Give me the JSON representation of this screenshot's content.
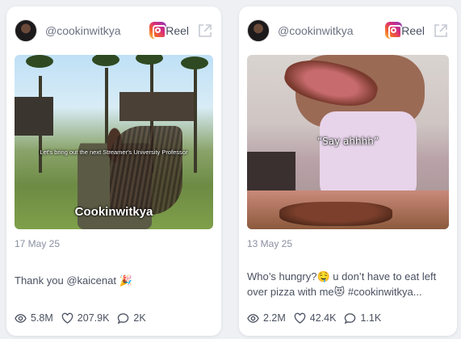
{
  "posts": [
    {
      "handle": "@cookinwitkya",
      "platform_label": "Reel",
      "overlay_small": "Let's bring out the next Streamer's University Professor",
      "overlay_big": "Cookinwitkya",
      "date": "17 May 25",
      "caption": "Thank you @kaicenat 🎉",
      "views": "5.8M",
      "likes": "207.9K",
      "comments": "2K"
    },
    {
      "handle": "@cookinwitkya",
      "platform_label": "Reel",
      "overlay_say": "“Say ahhhh”",
      "date": "13 May 25",
      "caption": "Who’s hungry?🤤 u don’t have to eat left over pizza with me😻 #cookinwitkya...",
      "views": "2.2M",
      "likes": "42.4K",
      "comments": "1.1K"
    }
  ],
  "icons": {
    "platform": "instagram-icon",
    "external": "external-link-icon",
    "views": "eye-icon",
    "likes": "heart-icon",
    "comments": "comment-icon"
  },
  "colors": {
    "background": "#eef0f4",
    "card": "#ffffff",
    "text": "#4a5060",
    "muted": "#8a90a0"
  }
}
